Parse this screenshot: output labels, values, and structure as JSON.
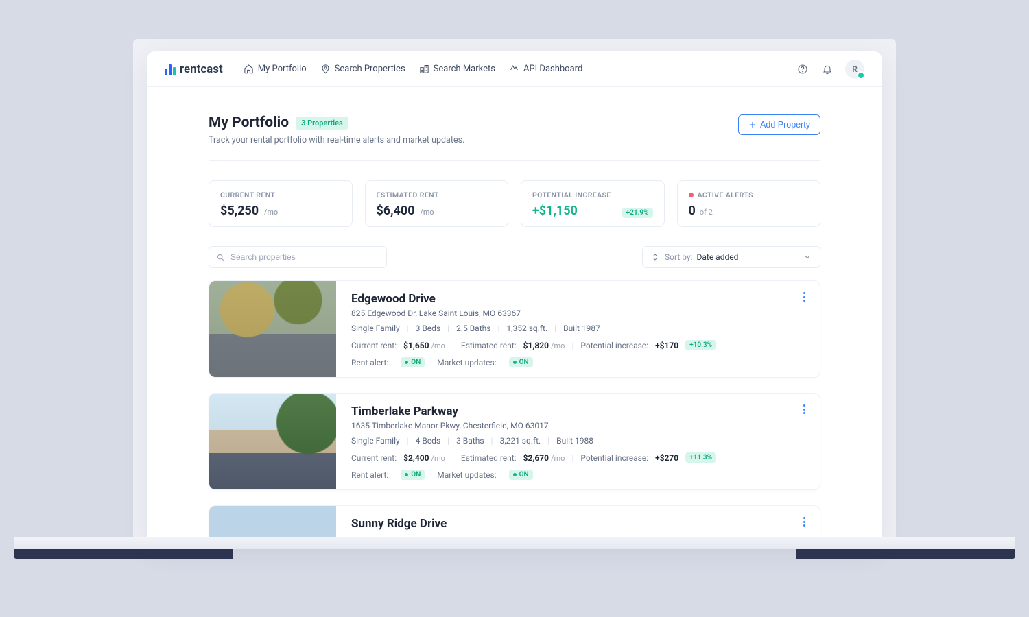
{
  "brand": "rentcast",
  "nav": {
    "portfolio": "My Portfolio",
    "search_properties": "Search Properties",
    "search_markets": "Search Markets",
    "api_dashboard": "API Dashboard"
  },
  "avatar_initial": "R",
  "page": {
    "title": "My Portfolio",
    "count_badge": "3 Properties",
    "subtitle": "Track your rental portfolio with real-time alerts and market updates.",
    "add_button": "Add Property"
  },
  "stats": {
    "current_rent": {
      "label": "CURRENT RENT",
      "value": "$5,250",
      "suffix": "/mo"
    },
    "estimated_rent": {
      "label": "ESTIMATED RENT",
      "value": "$6,400",
      "suffix": "/mo"
    },
    "potential_increase": {
      "label": "POTENTIAL INCREASE",
      "value": "+$1,150",
      "pct": "+21.9%"
    },
    "active_alerts": {
      "label": "ACTIVE ALERTS",
      "value": "0",
      "of": "of 2"
    }
  },
  "search": {
    "placeholder": "Search properties"
  },
  "sort": {
    "label": "Sort by:",
    "value": "Date added"
  },
  "labels": {
    "current_rent": "Current rent:",
    "estimated_rent": "Estimated rent:",
    "potential_increase": "Potential increase:",
    "rent_alert": "Rent alert:",
    "market_updates": "Market updates:",
    "permo": "/mo",
    "on": "ON"
  },
  "properties": [
    {
      "name": "Edgewood Drive",
      "address": "825 Edgewood Dr, Lake Saint Louis, MO 63367",
      "type": "Single Family",
      "beds": "3 Beds",
      "baths": "2.5 Baths",
      "sqft": "1,352 sq.ft.",
      "built": "Built 1987",
      "current_rent": "$1,650",
      "estimated_rent": "$1,820",
      "increase": "+$170",
      "increase_pct": "+10.3%",
      "rent_alert": "ON",
      "market_updates": "ON"
    },
    {
      "name": "Timberlake Parkway",
      "address": "1635 Timberlake Manor Pkwy, Chesterfield, MO 63017",
      "type": "Single Family",
      "beds": "4 Beds",
      "baths": "3 Baths",
      "sqft": "3,221 sq.ft.",
      "built": "Built 1988",
      "current_rent": "$2,400",
      "estimated_rent": "$2,670",
      "increase": "+$270",
      "increase_pct": "+11.3%",
      "rent_alert": "ON",
      "market_updates": "ON"
    },
    {
      "name": "Sunny Ridge Drive"
    }
  ]
}
